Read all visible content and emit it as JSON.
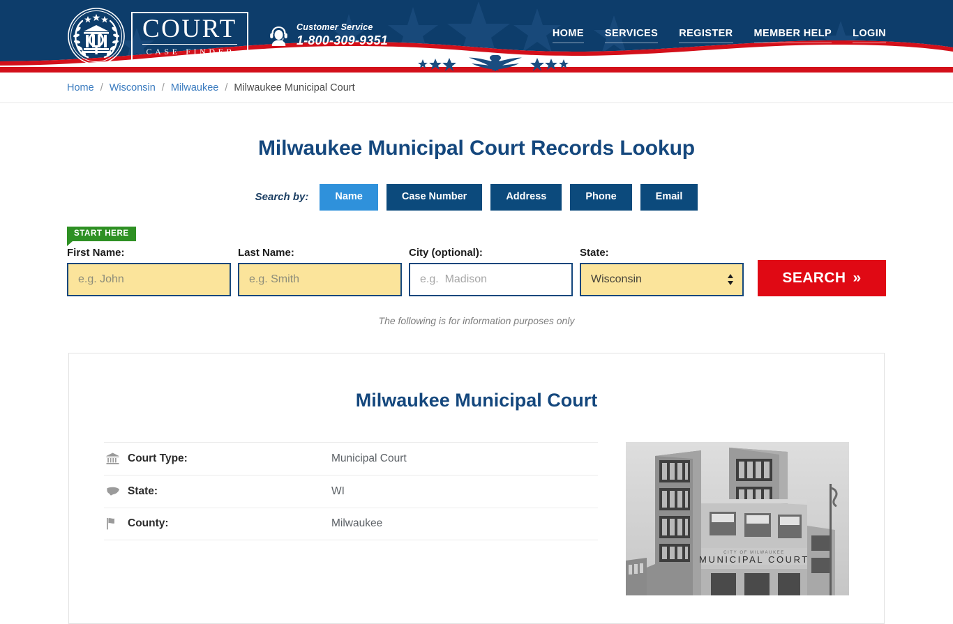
{
  "header": {
    "logo": {
      "word": "COURT",
      "sub": "CASE FINDER",
      "icon": "court-seal-logo"
    },
    "customer_service": {
      "label": "Customer Service",
      "phone": "1-800-309-9351",
      "icon": "headset-support-icon"
    },
    "nav": [
      {
        "label": "HOME",
        "name": "nav-home"
      },
      {
        "label": "SERVICES",
        "name": "nav-services"
      },
      {
        "label": "REGISTER",
        "name": "nav-register"
      },
      {
        "label": "MEMBER HELP",
        "name": "nav-member-help"
      },
      {
        "label": "LOGIN",
        "name": "nav-login"
      }
    ],
    "colors": {
      "navy": "#0d3d6b",
      "red": "#d3101a"
    }
  },
  "breadcrumb": {
    "items": [
      {
        "label": "Home",
        "current": false
      },
      {
        "label": "Wisconsin",
        "current": false
      },
      {
        "label": "Milwaukee",
        "current": false
      },
      {
        "label": "Milwaukee Municipal Court",
        "current": true
      }
    ],
    "separator": "/"
  },
  "search": {
    "page_title": "Milwaukee Municipal Court Records Lookup",
    "search_by_label": "Search by:",
    "tabs": [
      {
        "label": "Name",
        "active": true
      },
      {
        "label": "Case Number",
        "active": false
      },
      {
        "label": "Address",
        "active": false
      },
      {
        "label": "Phone",
        "active": false
      },
      {
        "label": "Email",
        "active": false
      }
    ],
    "start_here_badge": "START HERE",
    "fields": {
      "first_name": {
        "label": "First Name:",
        "placeholder": "e.g. John",
        "value": ""
      },
      "last_name": {
        "label": "Last Name:",
        "placeholder": "e.g. Smith",
        "value": ""
      },
      "city": {
        "label": "City (optional):",
        "placeholder": "e.g.  Madison",
        "value": ""
      },
      "state": {
        "label": "State:",
        "value": "Wisconsin"
      }
    },
    "search_button": "SEARCH",
    "search_button_arrow": "»",
    "disclaimer": "The following is for information purposes only",
    "colors": {
      "tab_active": "#2f91db",
      "tab_inactive": "#0c4a7c",
      "field_highlight": "#fbe49b",
      "field_border": "#14477d",
      "search_button": "#e00914",
      "start_here": "#2e9023",
      "title": "#14477d"
    }
  },
  "court_card": {
    "title": "Milwaukee Municipal Court",
    "details": [
      {
        "icon": "bank-institution-icon",
        "key": "Court Type:",
        "value": "Municipal Court"
      },
      {
        "icon": "us-map-icon",
        "key": "State:",
        "value": "WI"
      },
      {
        "icon": "flag-icon",
        "key": "County:",
        "value": "Milwaukee"
      }
    ],
    "photo": {
      "name": "milwaukee-municipal-court-building-photo",
      "sign_line1": "CITY OF MILWAUKEE",
      "sign_line2": "MUNICIPAL COURT"
    }
  }
}
